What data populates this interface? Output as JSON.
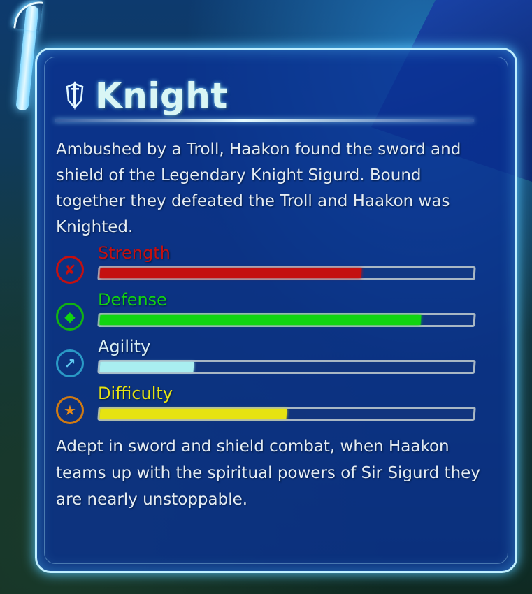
{
  "hero": {
    "title": "Knight",
    "icon": "sword-shield-icon",
    "description": "Ambushed by a Troll, Haakon found the sword and shield of the Legendary Knight Sigurd. Bound together they defeated the Troll and Haakon was Knighted.",
    "footer": "Adept in sword and shield combat, when Haakon teams up with the spiritual powers of Sir Sigurd they are nearly unstoppable."
  },
  "stats": [
    {
      "label": "Strength",
      "value": 0.7,
      "color": "#c41010",
      "icon": "strength-icon"
    },
    {
      "label": "Defense",
      "value": 0.86,
      "color": "#11d411",
      "icon": "defense-icon"
    },
    {
      "label": "Agility",
      "value": 0.25,
      "color": "#a9eef0",
      "icon": "agility-icon"
    },
    {
      "label": "Difficulty",
      "value": 0.5,
      "color": "#e6e312",
      "icon": "difficulty-icon"
    }
  ]
}
